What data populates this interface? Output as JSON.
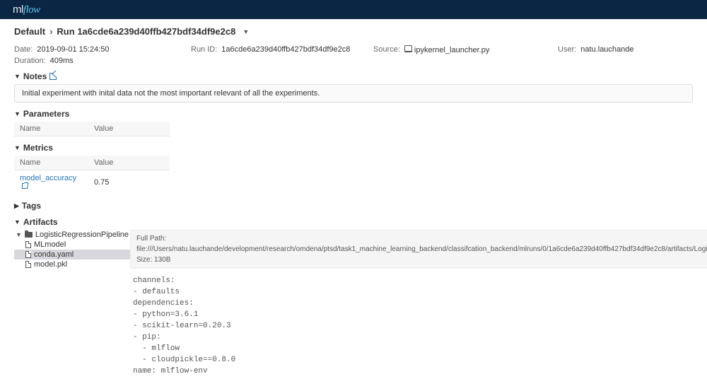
{
  "logo": {
    "ml": "ml",
    "flow": "flow"
  },
  "breadcrumb": {
    "root": "Default",
    "run_prefix": "Run",
    "run_id": "1a6cde6a239d40ffb427bdf34df9e2c8"
  },
  "meta": {
    "date_label": "Date:",
    "date_value": "2019-09-01 15:24:50",
    "runid_label": "Run ID:",
    "runid_value": "1a6cde6a239d40ffb427bdf34df9e2c8",
    "source_label": "Source:",
    "source_value": "ipykernel_launcher.py",
    "user_label": "User:",
    "user_value": "natu.lauchande",
    "duration_label": "Duration:",
    "duration_value": "409ms"
  },
  "sections": {
    "notes": "Notes",
    "params": "Parameters",
    "metrics": "Metrics",
    "tags": "Tags",
    "artifacts": "Artifacts"
  },
  "note_text": "Initial experiment with inital data not the most important relevant of all the experiments.",
  "table_headers": {
    "name": "Name",
    "value": "Value"
  },
  "metrics_rows": [
    {
      "name": "model_accuracy",
      "value": "0.75"
    }
  ],
  "tree": {
    "root": "LogisticRegressionPipeline",
    "children": [
      {
        "name": "MLmodel"
      },
      {
        "name": "conda.yaml",
        "selected": true
      },
      {
        "name": "model.pkl"
      }
    ]
  },
  "viewer": {
    "full_path_label": "Full Path:",
    "full_path_value": "file:///Users/natu.lauchande/development/research/omdena/ptsd/task1_machine_learning_backend/classifcation_backend/mlruns/0/1a6cde6a239d40ffb427bdf34df9e2c8/artifacts/LogisticRegressionPipeline/conda.yaml",
    "size_label": "Size:",
    "size_value": "130B",
    "content": "channels:\n- defaults\ndependencies:\n- python=3.6.1\n- scikit-learn=0.20.3\n- pip:\n  - mlflow\n  - cloudpickle==0.8.0\nname: mlflow-env"
  }
}
